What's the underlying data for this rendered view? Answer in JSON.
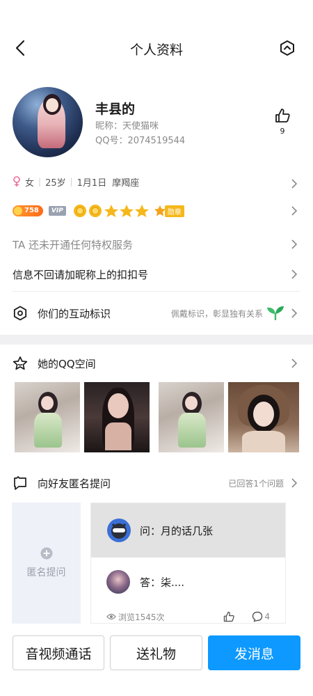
{
  "header": {
    "title": "个人资料"
  },
  "profile": {
    "name": "丰县的",
    "nickname": "昵称：天使猫咪",
    "qq": "QQ号：2074519544",
    "likes": "9"
  },
  "info": {
    "gender": "女",
    "age": "25岁",
    "birthday": "1月1日",
    "zodiac": "摩羯座"
  },
  "badges": {
    "level_number": "758",
    "vip_label": "VIP",
    "medal_label": "勋章"
  },
  "rows": {
    "privilege": "TA 还未开通任何特权服务",
    "note": "信息不回请加昵称上的扣扣号",
    "interaction_label": "你们的互动标识",
    "interaction_hint": "佩戴标识，彰显独有关系"
  },
  "qzone": {
    "title": "她的QQ空间"
  },
  "anon": {
    "title": "向好友匿名提问",
    "answered": "已回答1个问题",
    "ask_button": "匿名提问",
    "question": "问：月的话几张",
    "answer": "答：柒....",
    "views": "浏览1545次",
    "comments": "4"
  },
  "actions": {
    "call": "音视频通话",
    "gift": "送礼物",
    "message": "发消息"
  },
  "colors": {
    "accent": "#0d99ff",
    "gender_pink": "#f06a9b",
    "level_orange": "#ff7a1a",
    "gold": "#f5b81c"
  }
}
